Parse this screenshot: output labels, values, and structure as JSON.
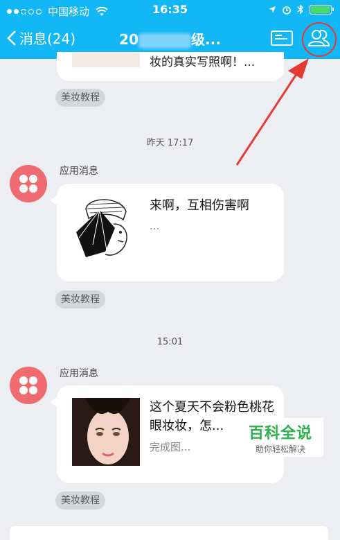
{
  "status_bar": {
    "carrier": "中国移动",
    "time": "16:35"
  },
  "nav": {
    "back_label": "消息(24)",
    "title_prefix": "20",
    "title_suffix": "级..."
  },
  "messages": [
    {
      "text": "妆的真实写照啊！...",
      "tag": "美妆教程"
    },
    {
      "timestamp": "昨天 17:17",
      "sender": "应用消息",
      "title": "来啊，互相伤害啊",
      "subtitle": "...",
      "tag": "美妆教程"
    },
    {
      "timestamp": "15:01",
      "sender": "应用消息",
      "title": "这个夏天不会粉色桃花眼妆妆，怎...",
      "subtitle": "完成图...",
      "tag": "美妆教程"
    }
  ],
  "watermark": {
    "title": "百科全说",
    "subtitle": "助你轻松解决"
  },
  "colors": {
    "nav": "#12b7f5",
    "avatar": "#ef6b70",
    "highlight": "#e53935"
  }
}
